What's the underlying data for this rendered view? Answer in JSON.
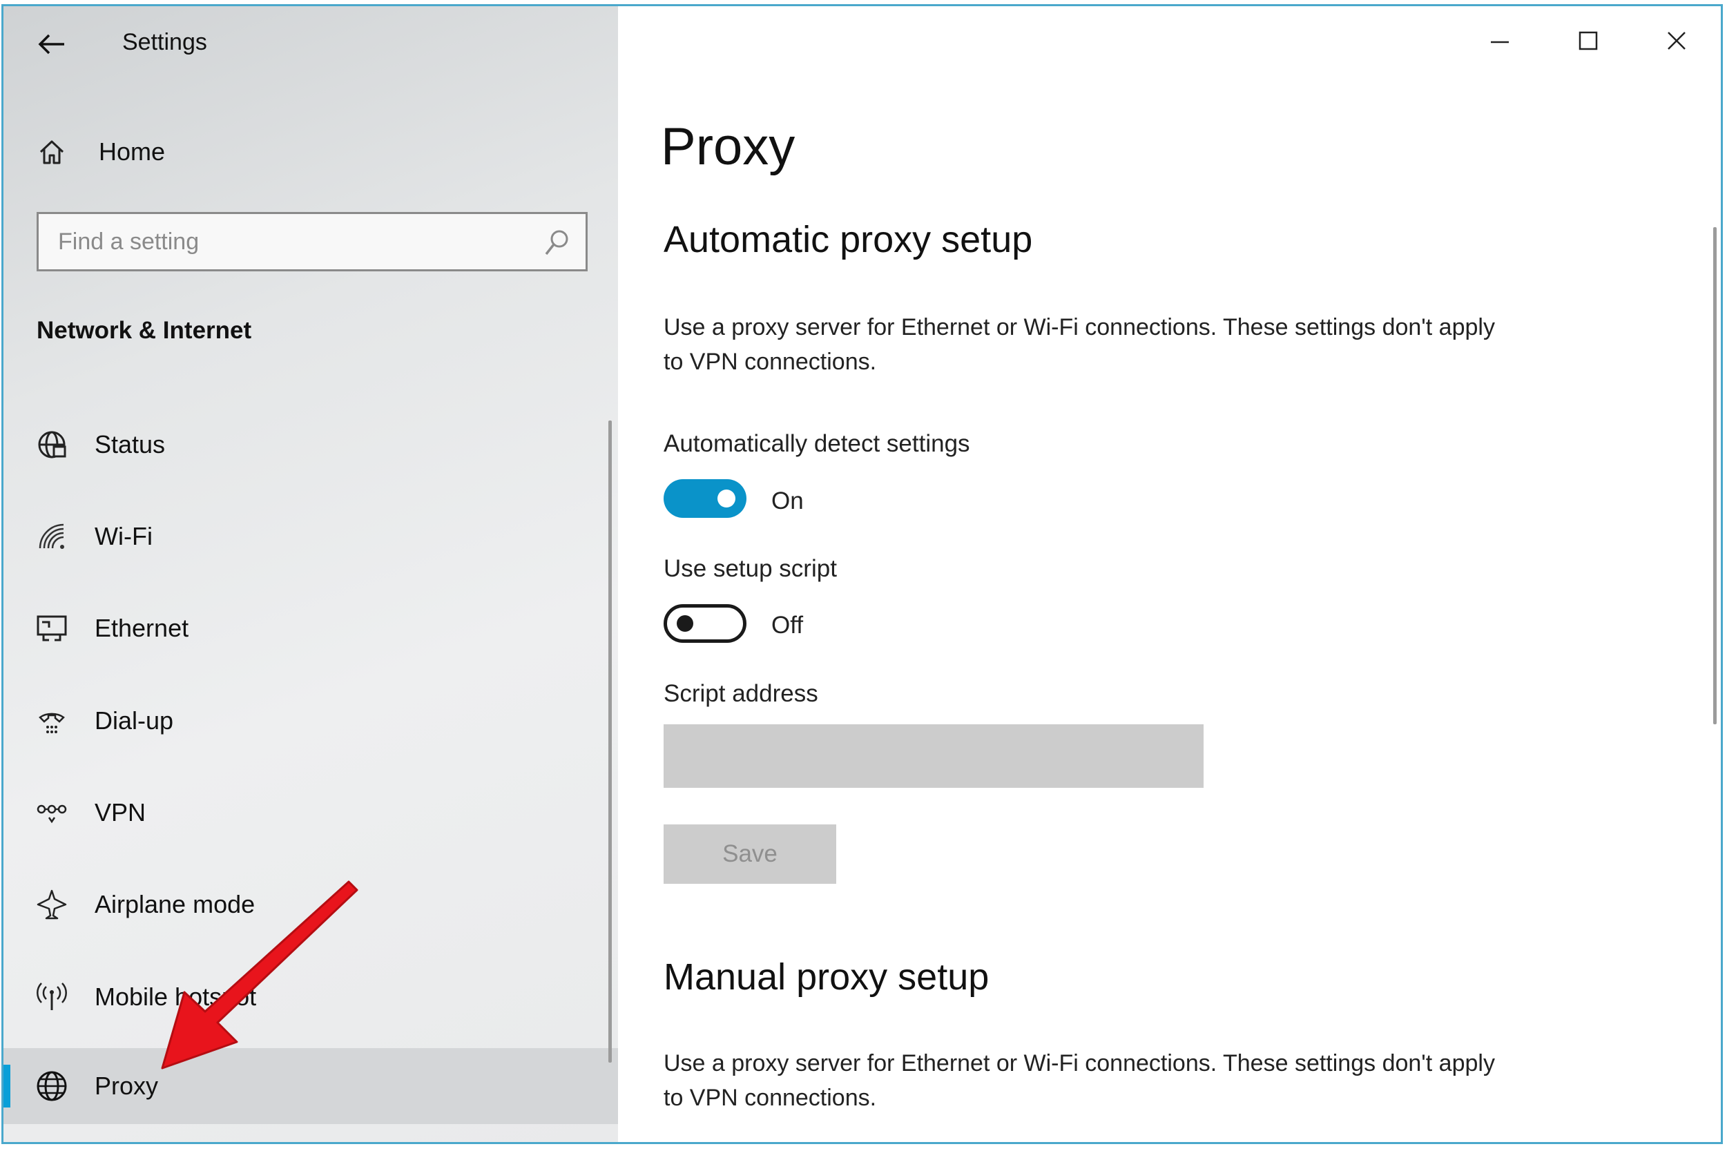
{
  "window": {
    "app_title": "Settings",
    "controls": {
      "minimize_icon": "minimize-icon",
      "maximize_icon": "maximize-icon",
      "close_icon": "close-icon"
    }
  },
  "sidebar": {
    "home_label": "Home",
    "search": {
      "placeholder": "Find a setting",
      "value": ""
    },
    "section_heading": "Network & Internet",
    "items": [
      {
        "label": "Status",
        "icon": "globe-status-icon",
        "selected": false
      },
      {
        "label": "Wi-Fi",
        "icon": "wifi-icon",
        "selected": false
      },
      {
        "label": "Ethernet",
        "icon": "ethernet-icon",
        "selected": false
      },
      {
        "label": "Dial-up",
        "icon": "dialup-icon",
        "selected": false
      },
      {
        "label": "VPN",
        "icon": "vpn-icon",
        "selected": false
      },
      {
        "label": "Airplane mode",
        "icon": "airplane-icon",
        "selected": false
      },
      {
        "label": "Mobile hotspot",
        "icon": "hotspot-icon",
        "selected": false
      },
      {
        "label": "Proxy",
        "icon": "globe-icon",
        "selected": true
      }
    ]
  },
  "main": {
    "page_title": "Proxy",
    "automatic": {
      "heading": "Automatic proxy setup",
      "description": "Use a proxy server for Ethernet or Wi-Fi connections. These settings don't apply to VPN connections.",
      "auto_detect": {
        "label": "Automatically detect settings",
        "state": "On",
        "enabled": true
      },
      "setup_script": {
        "label": "Use setup script",
        "state": "Off",
        "enabled": false
      },
      "script_address": {
        "label": "Script address",
        "value": ""
      },
      "save_label": "Save"
    },
    "manual": {
      "heading": "Manual proxy setup",
      "description": "Use a proxy server for Ethernet or Wi-Fi connections. These settings don't apply to VPN connections."
    }
  },
  "colors": {
    "accent": "#0a93c9",
    "window_border": "#4aa8cc",
    "annotation_arrow": "#e8141c"
  }
}
